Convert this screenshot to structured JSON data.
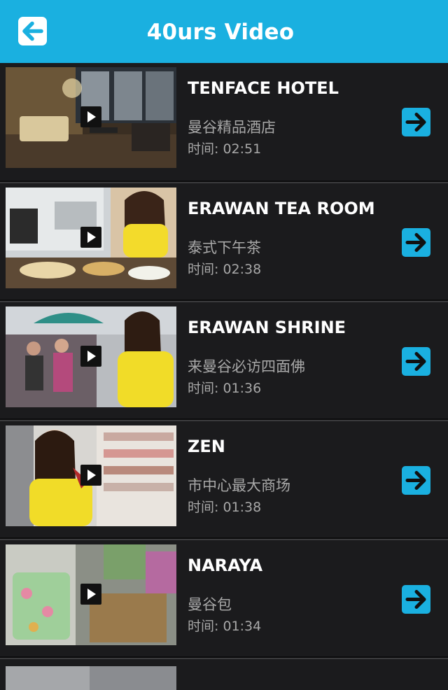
{
  "header": {
    "title": "40urs Video",
    "back_icon": "back-arrow-icon"
  },
  "videos": [
    {
      "name": "TENFACE HOTEL",
      "subtitle": "曼谷精品酒店",
      "time": "时间: 02:51"
    },
    {
      "name": "ERAWAN TEA ROOM",
      "subtitle": "泰式下午茶",
      "time": "时间: 02:38"
    },
    {
      "name": "ERAWAN SHRINE",
      "subtitle": "来曼谷必访四面佛",
      "time": "时间: 01:36"
    },
    {
      "name": "ZEN",
      "subtitle": "市中心最大商场",
      "time": "时间: 01:38"
    },
    {
      "name": "NARAYA",
      "subtitle": "曼谷包",
      "time": "时间: 01:34"
    }
  ],
  "colors": {
    "accent": "#1ab0e0",
    "background": "#1b1b1d"
  }
}
